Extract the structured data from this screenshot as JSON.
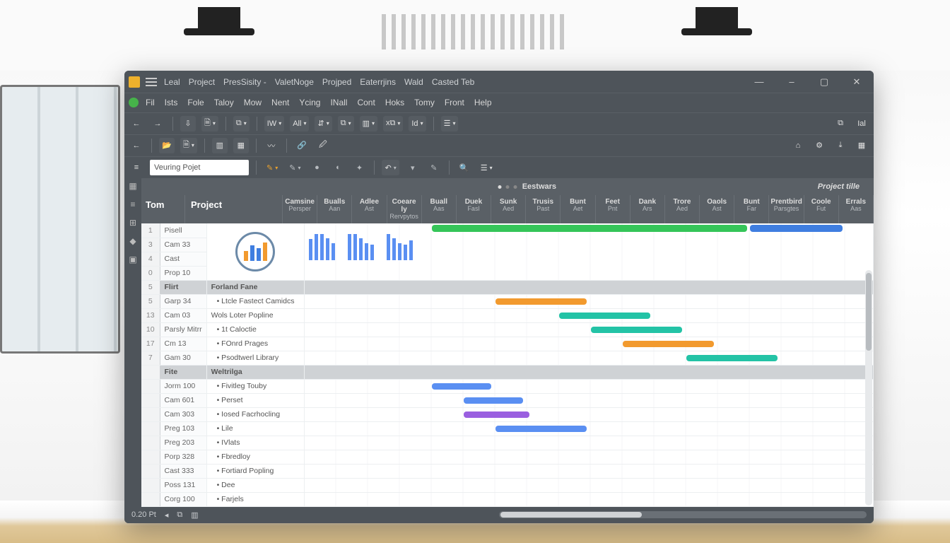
{
  "titlebar": {
    "items": [
      "Leal",
      "Project",
      "PresSisity -",
      "ValetNoge",
      "Projped",
      "Eaterrjins",
      "Wald",
      "Casted Teb"
    ]
  },
  "window_controls": {
    "min": "—",
    "dash": "–",
    "max": "▢",
    "close": "✕"
  },
  "menubar": {
    "items": [
      "Fil",
      "Ists",
      "Fole",
      "Taloy",
      "Mow",
      "Nent",
      "Ycing",
      "INall",
      "Cont",
      "Hoks",
      "Tomy",
      "Front",
      "Help"
    ]
  },
  "toolbar1": {
    "back": "←",
    "fwd": "→",
    "t1": "⇩",
    "t2": "🗎",
    "t3": "⧉",
    "d1": "IW",
    "d2": "All",
    "d3": "⇵",
    "d4": "⧉",
    "d5": "▥",
    "d6": "x⧉",
    "d7": "Id",
    "d8": "☰",
    "r1": "⧉",
    "r2": "Ial"
  },
  "toolbar2": {
    "back": "←",
    "t1": "📂",
    "t2": "🗎",
    "t3": "▥",
    "t4": "▦",
    "t5": "〰",
    "t6": "🔗",
    "t7": "🖉",
    "r1": "⌂",
    "r2": "⚙",
    "r3": "⤓",
    "r4": "▦"
  },
  "toolbar3": {
    "ham": "≡",
    "project_name": "Veuring Pojet",
    "p1": "✎",
    "p2": "✎",
    "p3": "●",
    "p4": "◐",
    "p5": "✦",
    "s1": "↶",
    "s2": "▾",
    "s3": "✎",
    "s4": "🔍",
    "s5": "☰"
  },
  "section_header": {
    "center": "Eestwars",
    "right": "Project tille"
  },
  "columns": {
    "a": "Tom",
    "b": "Project",
    "periods": [
      {
        "l1": "Camsine",
        "l2": "Persper"
      },
      {
        "l1": "Bualls",
        "l2": "Aan"
      },
      {
        "l1": "Adlee",
        "l2": "Ast"
      },
      {
        "l1": "Coeare ly",
        "l2": "Rervpytos"
      },
      {
        "l1": "Buall",
        "l2": "Aas"
      },
      {
        "l1": "Duek",
        "l2": "Fasl"
      },
      {
        "l1": "Sunk",
        "l2": "Aed"
      },
      {
        "l1": "Trusis",
        "l2": "Past"
      },
      {
        "l1": "Bunt",
        "l2": "Aet"
      },
      {
        "l1": "Feet",
        "l2": "Pnt"
      },
      {
        "l1": "Dank",
        "l2": "Ars"
      },
      {
        "l1": "Trore",
        "l2": "Aed"
      },
      {
        "l1": "Oaols",
        "l2": "Ast"
      },
      {
        "l1": "Bunt",
        "l2": "Far"
      },
      {
        "l1": "Prentbird",
        "l2": "Parsgtes"
      },
      {
        "l1": "Coole",
        "l2": "Fut"
      },
      {
        "l1": "Errals",
        "l2": "Aas"
      }
    ]
  },
  "rows": [
    {
      "num": "1",
      "label": "Pisell",
      "task": "",
      "type": "logo"
    },
    {
      "num": "3",
      "label": "Cam 33",
      "task": "",
      "type": "logo"
    },
    {
      "num": "4",
      "label": "Cast",
      "task": "",
      "type": "logo"
    },
    {
      "num": "0",
      "label": "Prop 10",
      "task": "",
      "type": "logo"
    },
    {
      "num": "5",
      "label": "Flirt",
      "task": "Forland Fane",
      "type": "section"
    },
    {
      "num": "5",
      "label": "Garp 34",
      "task": "• Ltcle Fastect Camidcs",
      "type": "bar",
      "color": "orange",
      "start": 6,
      "span": 3
    },
    {
      "num": "13",
      "label": "Cam 03",
      "task": "Wols Loter Popline",
      "type": "bar",
      "color": "teal",
      "start": 8,
      "span": 3
    },
    {
      "num": "10",
      "label": "Parsly Mitrr",
      "task": "• 1t Caloctie",
      "type": "bar",
      "color": "teal",
      "start": 9,
      "span": 3
    },
    {
      "num": "17",
      "label": "Cm 13",
      "task": "• FOnrd Prages",
      "type": "bar",
      "color": "orange",
      "start": 10,
      "span": 3
    },
    {
      "num": "7",
      "label": "Gam 30",
      "task": "• Psodtwerl Library",
      "type": "bar",
      "color": "teal",
      "start": 12,
      "span": 3
    },
    {
      "num": "",
      "label": "Fite",
      "task": "Weltrilga",
      "type": "section"
    },
    {
      "num": "",
      "label": "Jorm 100",
      "task": "• Fivitleg Touby",
      "type": "bar",
      "color": "bluel",
      "start": 4,
      "span": 2
    },
    {
      "num": "",
      "label": "Cam 601",
      "task": "• Perset",
      "type": "bar",
      "color": "bluel",
      "start": 5,
      "span": 2
    },
    {
      "num": "",
      "label": "Cam 303",
      "task": "• Iosed Facrhocling",
      "type": "bar",
      "color": "purple",
      "start": 5,
      "span": 2.2
    },
    {
      "num": "",
      "label": "Preg 103",
      "task": "• Lile",
      "type": "bar",
      "color": "bluel",
      "start": 6,
      "span": 3
    },
    {
      "num": "",
      "label": "Preg 203",
      "task": "• IVlats",
      "type": "plain"
    },
    {
      "num": "",
      "label": "Porp 328",
      "task": "• Fbredloy",
      "type": "plain"
    },
    {
      "num": "",
      "label": "Cast 333",
      "task": "• Fortiard Popling",
      "type": "plain"
    },
    {
      "num": "",
      "label": "Poss 131",
      "task": "• Dee",
      "type": "plain"
    },
    {
      "num": "",
      "label": "Corg 100",
      "task": "• Farjels",
      "type": "plain"
    }
  ],
  "statusbar": {
    "left": "0.20 Pt",
    "i1": "◂",
    "i2": "⧉",
    "i3": "▥"
  },
  "gutter_icons": [
    "▦",
    "≡",
    "⊞",
    "◆",
    "▣"
  ],
  "chart_data": {
    "type": "gantt",
    "title": "Project tille",
    "xlabel": "Eestwars",
    "categories": [
      "Camsine",
      "Bualls",
      "Adlee",
      "Coeare ly",
      "Buall",
      "Duek",
      "Sunk",
      "Trusis",
      "Bunt",
      "Feet",
      "Dank",
      "Trore",
      "Oaols",
      "Bunt",
      "Prentbird",
      "Coole",
      "Errals"
    ],
    "groups": [
      {
        "name": "Forland Fane",
        "tasks": [
          {
            "name": "Ltcle Fastect Camidcs",
            "start": 6,
            "duration": 3,
            "color": "#f29a2e"
          },
          {
            "name": "Wols Loter Popline",
            "start": 8,
            "duration": 3,
            "color": "#23c3a6"
          },
          {
            "name": "1t Caloctie",
            "start": 9,
            "duration": 3,
            "color": "#23c3a6"
          },
          {
            "name": "FOnrd Prages",
            "start": 10,
            "duration": 3,
            "color": "#f29a2e"
          },
          {
            "name": "Psodtwerl Library",
            "start": 12,
            "duration": 3,
            "color": "#23c3a6"
          }
        ]
      },
      {
        "name": "Weltrilga",
        "tasks": [
          {
            "name": "Fivitleg Touby",
            "start": 4,
            "duration": 2,
            "color": "#5a8ff2"
          },
          {
            "name": "Perset",
            "start": 5,
            "duration": 2,
            "color": "#5a8ff2"
          },
          {
            "name": "Iosed Facrhocling",
            "start": 5,
            "duration": 2.2,
            "color": "#9a5fe0"
          },
          {
            "name": "Lile",
            "start": 6,
            "duration": 3,
            "color": "#5a8ff2"
          }
        ]
      }
    ],
    "summary_bar": {
      "start": 4,
      "end": 17,
      "segments": [
        {
          "from": 4,
          "to": 14,
          "color": "#35c559"
        },
        {
          "from": 14,
          "to": 17,
          "color": "#3f7ee0"
        }
      ]
    }
  }
}
